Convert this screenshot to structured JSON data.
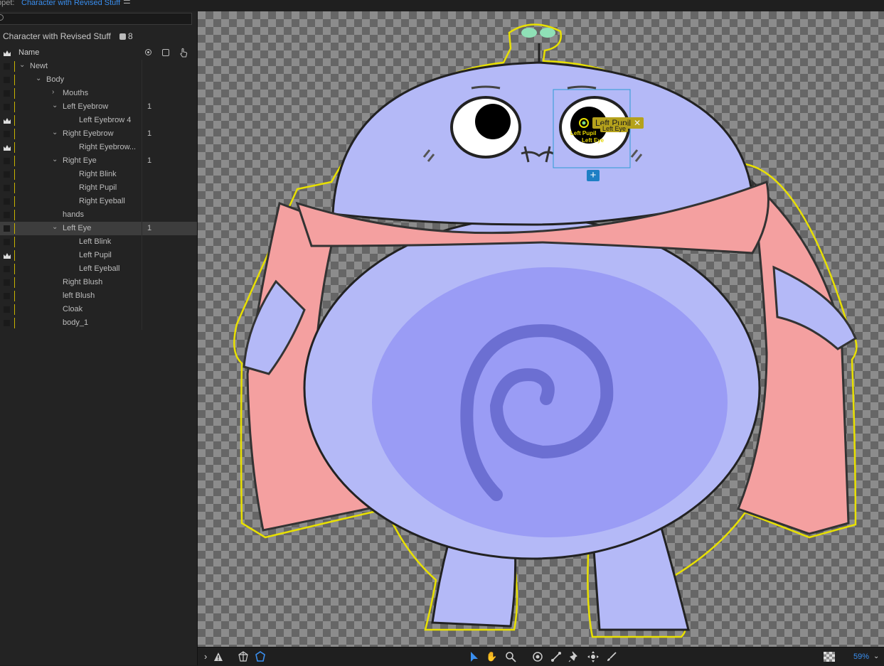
{
  "topbar": {
    "label": "ppet:",
    "puppet_name": "Character with Revised Stuff",
    "menu_icon": "hamburger-icon"
  },
  "sidebar": {
    "puppet_title": "Character with Revised Stuff",
    "puppet_count": "8",
    "header": {
      "name_label": "Name"
    },
    "rows": [
      {
        "label": "Newt",
        "count": ""
      },
      {
        "label": "Body",
        "count": ""
      },
      {
        "label": "Mouths",
        "count": ""
      },
      {
        "label": "Left Eyebrow",
        "count": "1"
      },
      {
        "label": "Left Eyebrow 4",
        "count": ""
      },
      {
        "label": "Right Eyebrow",
        "count": "1"
      },
      {
        "label": "Right Eyebrow...",
        "count": ""
      },
      {
        "label": "Right Eye",
        "count": "1"
      },
      {
        "label": "Right Blink",
        "count": ""
      },
      {
        "label": "Right Pupil",
        "count": ""
      },
      {
        "label": "Right Eyeball",
        "count": ""
      },
      {
        "label": "hands",
        "count": ""
      },
      {
        "label": "Left Eye",
        "count": "1"
      },
      {
        "label": "Left Blink",
        "count": ""
      },
      {
        "label": "Left Pupil",
        "count": ""
      },
      {
        "label": "Left Eyeball",
        "count": ""
      },
      {
        "label": "Right Blush",
        "count": ""
      },
      {
        "label": "left Blush",
        "count": ""
      },
      {
        "label": "Cloak",
        "count": ""
      },
      {
        "label": "body_1",
        "count": ""
      }
    ]
  },
  "canvas": {
    "handle_tag": "Left Pupil",
    "handle_tag_close": "✕",
    "tag_sub1": "Left Pupil",
    "tag_sub2": "Left Eye",
    "tag_sub3": "Left Eye",
    "add_button": "+"
  },
  "bottombar": {
    "zoom": "59%"
  },
  "colors": {
    "accent": "#3a8ff0",
    "tag_yellow": "#b5a21c",
    "outline": "#e8e000",
    "body": "#b4b9f7",
    "cloak": "#f4a0a0"
  }
}
